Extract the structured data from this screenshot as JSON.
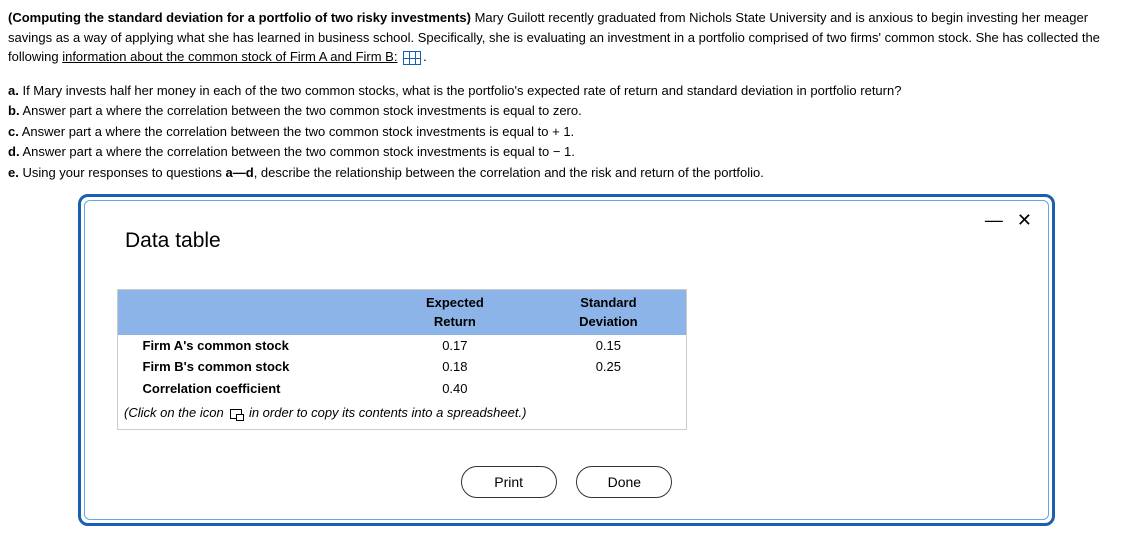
{
  "intro": {
    "bold_lead": "(Computing the standard deviation for a portfolio of two risky investments)",
    "rest1": " Mary Guilott recently graduated from Nichols State University and is anxious to begin investing her meager savings as a way of applying what she has learned in business school. Specifically, she is evaluating an investment in a portfolio comprised of two firms' common stock. She has collected the following ",
    "underlined": "information about the common stock of Firm A and Firm B:",
    "trail": "."
  },
  "questions": {
    "a": {
      "lbl": "a.",
      "txt": " If Mary invests half her money in each of the two common stocks, what is the portfolio's expected rate of return and standard deviation in portfolio return?"
    },
    "b": {
      "lbl": "b.",
      "txt": " Answer part a where the correlation between the two common stock investments is equal to zero."
    },
    "c": {
      "lbl": "c.",
      "txt": " Answer part a where the correlation between the two common stock investments is equal to + 1."
    },
    "d": {
      "lbl": "d.",
      "txt": " Answer part a where the correlation between the two common stock investments is equal to − 1."
    },
    "e": {
      "pre": "e.",
      "txt1": " Using your responses to questions ",
      "range": "a—d",
      "txt2": ", describe the relationship between the correlation and the risk and return of the portfolio."
    }
  },
  "modal": {
    "title": "Data table",
    "headers": {
      "blank": "",
      "expected": "Expected Return",
      "stddev": "Standard Deviation"
    },
    "rows": [
      {
        "label": "Firm A's common stock",
        "expected": "0.17",
        "stddev": "0.15"
      },
      {
        "label": "Firm B's common stock",
        "expected": "0.18",
        "stddev": "0.25"
      },
      {
        "label": "Correlation coefficient",
        "expected": "0.40",
        "stddev": ""
      }
    ],
    "hint_pre": "(Click on the icon ",
    "hint_post": " in order to copy its contents into a spreadsheet.)",
    "buttons": {
      "print": "Print",
      "done": "Done"
    }
  },
  "chart_data": {
    "type": "table",
    "columns": [
      "",
      "Expected Return",
      "Standard Deviation"
    ],
    "rows": [
      [
        "Firm A's common stock",
        0.17,
        0.15
      ],
      [
        "Firm B's common stock",
        0.18,
        0.25
      ],
      [
        "Correlation coefficient",
        0.4,
        null
      ]
    ]
  }
}
